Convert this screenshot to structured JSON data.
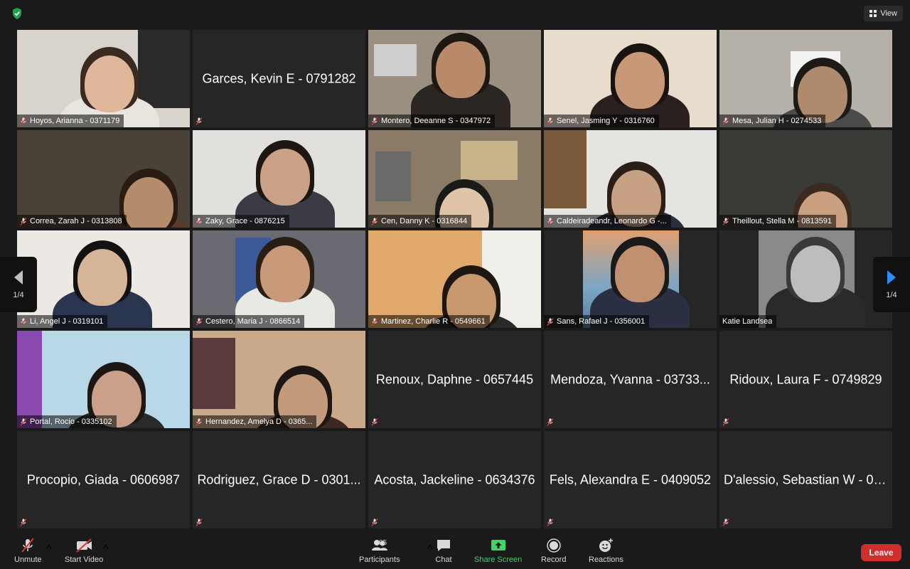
{
  "view_label": "View",
  "pager": {
    "left_label": "1/4",
    "right_label": "1/4"
  },
  "tiles": [
    {
      "name": "Hoyos, Arianna - 0371179",
      "video": true
    },
    {
      "name": "Garces, Kevin E - 0791282",
      "video": false
    },
    {
      "name": "Montero, Deeanne S - 0347972",
      "video": true
    },
    {
      "name": "Senel, Jasming Y - 0316760",
      "video": true,
      "active": true
    },
    {
      "name": "Mesa, Julian H - 0274533",
      "video": true
    },
    {
      "name": "Correa, Zarah J - 0313808",
      "video": true
    },
    {
      "name": "Zaky, Grace - 0876215",
      "video": true
    },
    {
      "name": "Cen, Danny K - 0316844",
      "video": true
    },
    {
      "name": "Caldeiradeandr, Leonardo G -...",
      "video": true
    },
    {
      "name": "Theillout, Stella M - 0813591",
      "video": true
    },
    {
      "name": "Li, Angel J - 0319101",
      "video": true
    },
    {
      "name": "Cestero, Maria J - 0866514",
      "video": true
    },
    {
      "name": "Martinez, Charlie R - 0549661",
      "video": true
    },
    {
      "name": "Sans, Rafael J - 0356001",
      "video": true
    },
    {
      "name": "Katie Landsea",
      "video": true
    },
    {
      "name": "Portal, Rocio - 0335102",
      "video": true
    },
    {
      "name": "Hernandez, Amelya D - 0365...",
      "video": true
    },
    {
      "name": "Renoux, Daphne - 0657445",
      "video": false
    },
    {
      "name": "Mendoza, Yvanna - 03733...",
      "video": false
    },
    {
      "name": "Ridoux, Laura F - 0749829",
      "video": false
    },
    {
      "name": "Procopio, Giada - 0606987",
      "video": false
    },
    {
      "name": "Rodriguez, Grace D - 0301...",
      "video": false
    },
    {
      "name": "Acosta, Jackeline - 0634376",
      "video": false
    },
    {
      "name": "Fels, Alexandra E - 0409052",
      "video": false
    },
    {
      "name": "D'alessio, Sebastian W - 04...",
      "video": false
    }
  ],
  "toolbar": {
    "unmute": "Unmute",
    "start_video": "Start Video",
    "participants": "Participants",
    "participants_count": "85",
    "chat": "Chat",
    "share_screen": "Share Screen",
    "record": "Record",
    "reactions": "Reactions",
    "leave": "Leave"
  },
  "colors": {
    "active_outline": "#e8e86a",
    "share_green": "#3fd36a",
    "leave_red": "#cf2e2e",
    "tile_bg": "#262626"
  }
}
